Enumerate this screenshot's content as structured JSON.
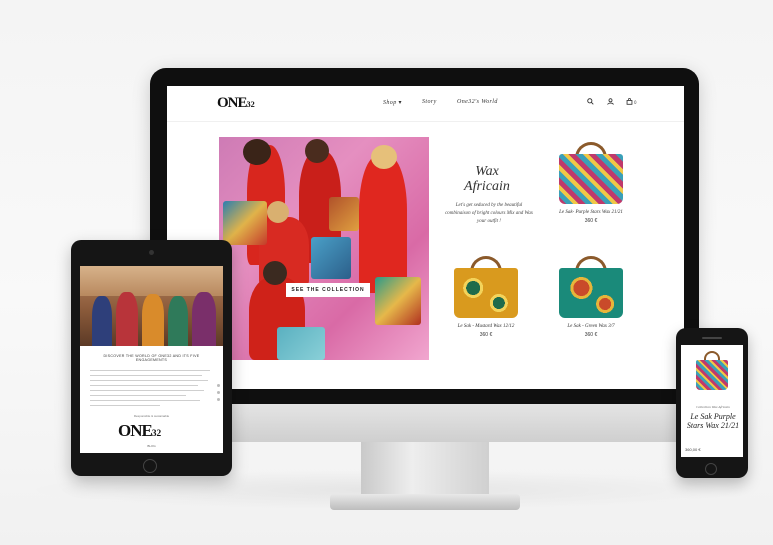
{
  "desktop": {
    "logo": {
      "main": "ONE",
      "sub": "32"
    },
    "nav": {
      "items": [
        {
          "label": "Shop"
        },
        {
          "label": "Story"
        },
        {
          "label": "One32's World"
        }
      ],
      "shop_chevron": "▾",
      "cart_count": "0"
    },
    "hero": {
      "button_label": "SEE THE COLLECTION"
    },
    "feature": {
      "title_line1": "Wax",
      "title_line2": "Africain",
      "description": "Let's get seduced by the beautiful combinaison of bright colours Mix and Wax your outfit !"
    },
    "products": [
      {
        "name": "Le Sak- Purple Stars Wax 21/21",
        "price": "360 €",
        "colors": [
          "#c0396b",
          "#3aa0b8",
          "#f0c846"
        ]
      },
      {
        "name": "Le Sak - Mustard Wax 12/12",
        "price": "360 €",
        "colors": [
          "#d99a1e",
          "#1f6b4b",
          "#f3d35a"
        ]
      },
      {
        "name": "Le Sak - Green Wax 3/7",
        "price": "360 €",
        "colors": [
          "#1a8a7a",
          "#c94a2a",
          "#e7b53a"
        ]
      }
    ]
  },
  "tablet": {
    "heading": "DISCOVER THE WORLD OF ONE32 AND ITS FIVE ENGAGEMENTS",
    "logo": {
      "main": "ONE",
      "sub": "32"
    },
    "caption": "BLOG",
    "kicker": "Responsible & sustainable"
  },
  "phone": {
    "kicker": "Collection Wax Africain",
    "title": "Le Sak Purple Stars Wax 21/21",
    "price": "360,00 €"
  },
  "colors": {
    "hero_pink": "#e58fc0",
    "dress_red": "#d8261e",
    "bezel": "#0f0f0f"
  }
}
